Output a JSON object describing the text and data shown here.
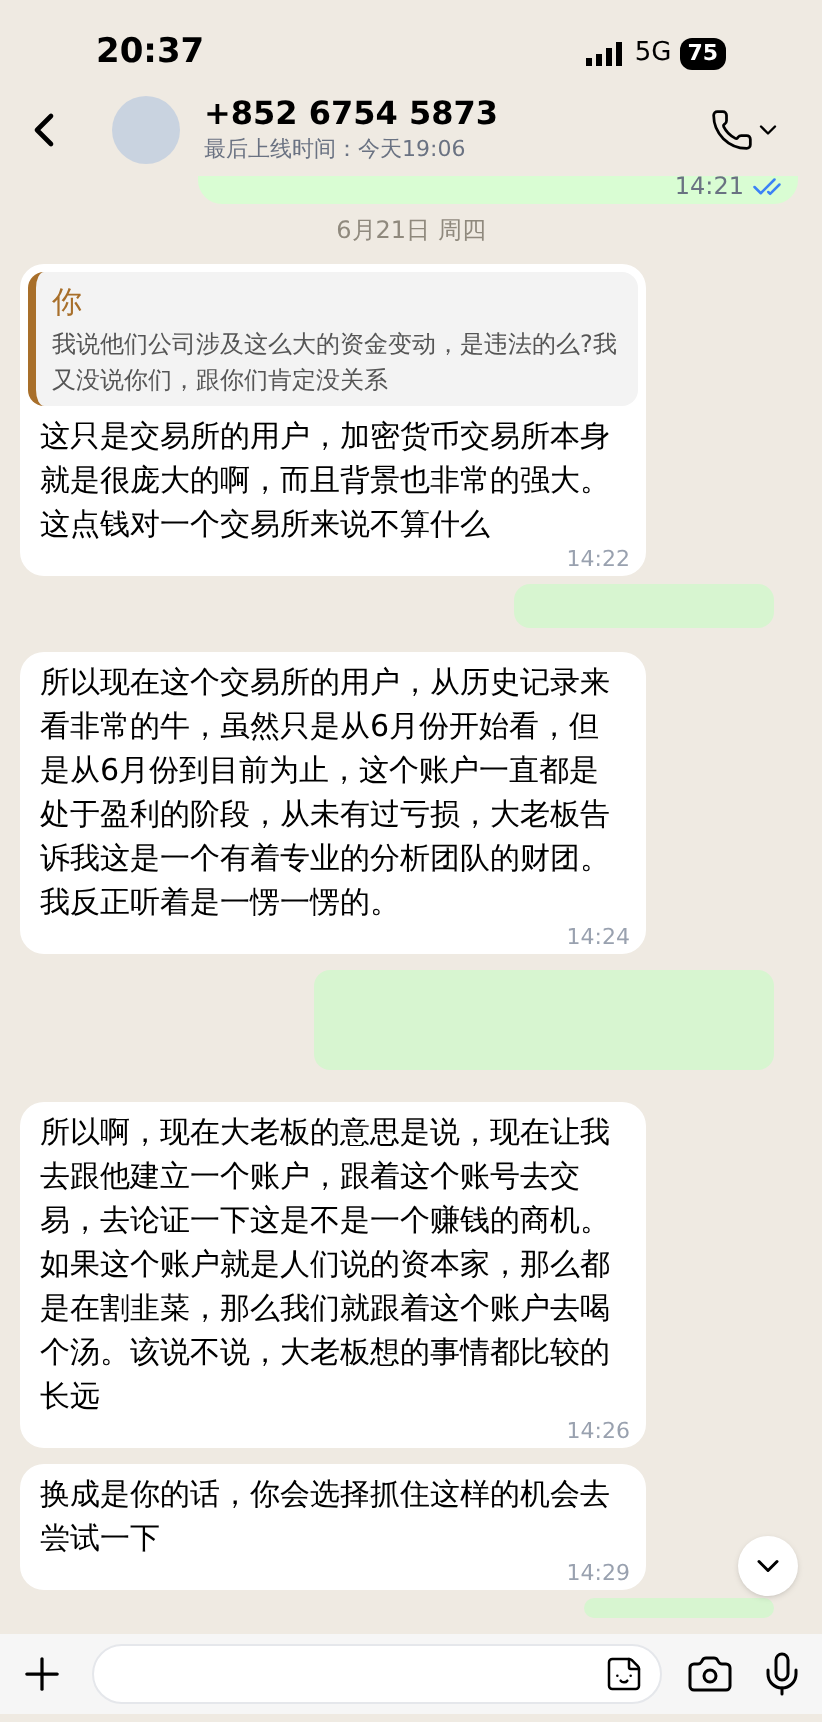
{
  "status_bar": {
    "time": "20:37",
    "network": "5G",
    "battery": "75"
  },
  "header": {
    "title": "+852 6754 5873",
    "subtitle": "最后上线时间：今天19:06"
  },
  "messages": [
    {
      "kind": "outgoing",
      "time": "14:21",
      "read": true
    },
    {
      "kind": "date",
      "text": "6月21日 周四"
    },
    {
      "kind": "incoming",
      "quote": {
        "author": "你",
        "text": "我说他们公司涉及这么大的资金变动，是违法的么?我又没说你们，跟你们肯定没关系"
      },
      "text": "这只是交易所的用户，加密货币交易所本身就是很庞大的啊，而且背景也非常的强大。这点钱对一个交易所来说不算什么",
      "time": "14:22"
    },
    {
      "kind": "redacted"
    },
    {
      "kind": "incoming",
      "text": "所以现在这个交易所的用户，从历史记录来看非常的牛，虽然只是从6月份开始看，但是从6月份到目前为止，这个账户一直都是处于盈利的阶段，从未有过亏损，大老板告诉我这是一个有着专业的分析团队的财团。我反正听着是一愣一愣的。",
      "time": "14:24"
    },
    {
      "kind": "smudge"
    },
    {
      "kind": "incoming",
      "text": "所以啊，现在大老板的意思是说，现在让我去跟他建立一个账户，跟着这个账号去交易，去论证一下这是不是一个赚钱的商机。如果这个账户就是人们说的资本家，那么都是在割韭菜，那么我们就跟着这个账户去喝个汤。该说不说，大老板想的事情都比较的长远",
      "time": "14:26"
    },
    {
      "kind": "incoming",
      "text": "换成是你的话，你会选择抓住这样的机会去尝试一下",
      "time": "14:29"
    },
    {
      "kind": "sliver"
    }
  ]
}
